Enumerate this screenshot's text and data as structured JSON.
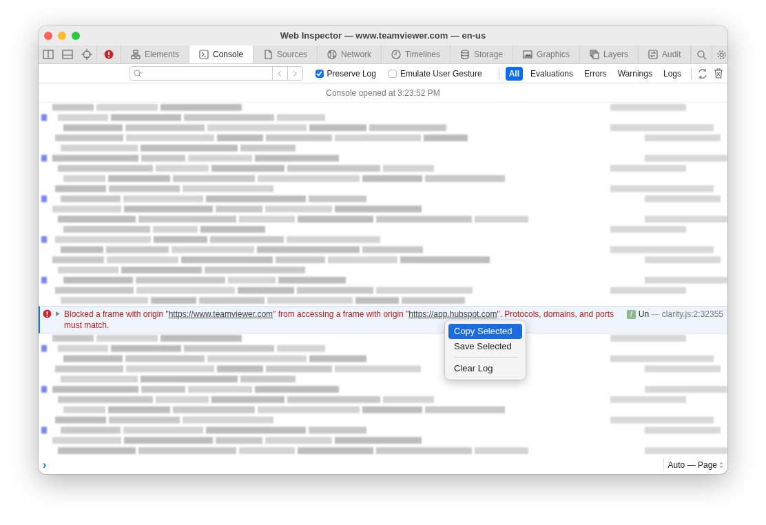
{
  "window": {
    "title": "Web Inspector — www.teamviewer.com — en-us"
  },
  "tabs": [
    {
      "label": "Elements",
      "selected": false
    },
    {
      "label": "Console",
      "selected": true
    },
    {
      "label": "Sources",
      "selected": false
    },
    {
      "label": "Network",
      "selected": false
    },
    {
      "label": "Timelines",
      "selected": false
    },
    {
      "label": "Storage",
      "selected": false
    },
    {
      "label": "Graphics",
      "selected": false
    },
    {
      "label": "Layers",
      "selected": false
    },
    {
      "label": "Audit",
      "selected": false
    }
  ],
  "filter_bar": {
    "options": [
      {
        "label": "Preserve Log",
        "checked": true
      },
      {
        "label": "Emulate User Gesture",
        "checked": false
      }
    ],
    "levels": [
      {
        "label": "All",
        "selected": true
      },
      {
        "label": "Evaluations",
        "selected": false
      },
      {
        "label": "Errors",
        "selected": false
      },
      {
        "label": "Warnings",
        "selected": false
      },
      {
        "label": "Logs",
        "selected": false
      }
    ]
  },
  "console": {
    "opened_notice": "Console opened at 3:23:52 PM",
    "error": {
      "message_parts": [
        {
          "kind": "text",
          "text": "Blocked a frame with origin \""
        },
        {
          "kind": "link",
          "text": "https://www.teamviewer.com"
        },
        {
          "kind": "text",
          "text": "\" from accessing a frame with origin \""
        },
        {
          "kind": "link",
          "text": "https://app.hubspot.com"
        },
        {
          "kind": "text",
          "text": "\". Protocols, domains, and ports must match."
        }
      ],
      "function_badge": "f",
      "function_name": "Un",
      "separator": "—",
      "source": "clarity.js:2:32355"
    },
    "prompt": "›",
    "context_selector": "Auto — Page"
  },
  "context_menu": [
    {
      "kind": "item",
      "label": "Copy Selected",
      "selected": true
    },
    {
      "kind": "item",
      "label": "Save Selected",
      "selected": false
    },
    {
      "kind": "separator"
    },
    {
      "kind": "item",
      "label": "Clear Log",
      "selected": false
    }
  ]
}
